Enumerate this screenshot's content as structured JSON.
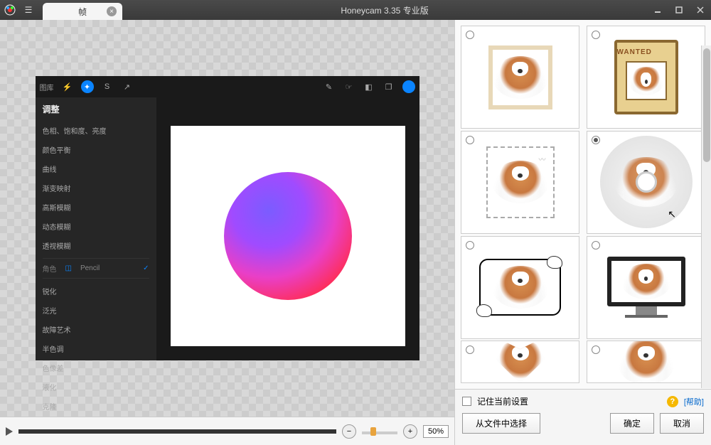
{
  "titlebar": {
    "tab_label": "帧",
    "app_title": "Honeycam 3.35 专业版"
  },
  "preview": {
    "library_label": "图库",
    "panel_title": "调整",
    "items": [
      "色相、饱和度、亮度",
      "颜色平衡",
      "曲线",
      "渐变映射",
      "高斯模糊",
      "动态模糊",
      "透视模糊"
    ],
    "layer_label": "角色",
    "pencil_label": "Pencil",
    "items2": [
      "锐化",
      "泛光",
      "故障艺术",
      "半色调",
      "色像差",
      "液化",
      "克隆"
    ]
  },
  "controls": {
    "zoom_value": "50%"
  },
  "thumbs": {
    "wanted_label": "WANTED"
  },
  "bottom": {
    "remember_label": "记住当前设置",
    "help_label": "[帮助]",
    "select_file_label": "从文件中选择",
    "ok_label": "确定",
    "cancel_label": "取消"
  }
}
